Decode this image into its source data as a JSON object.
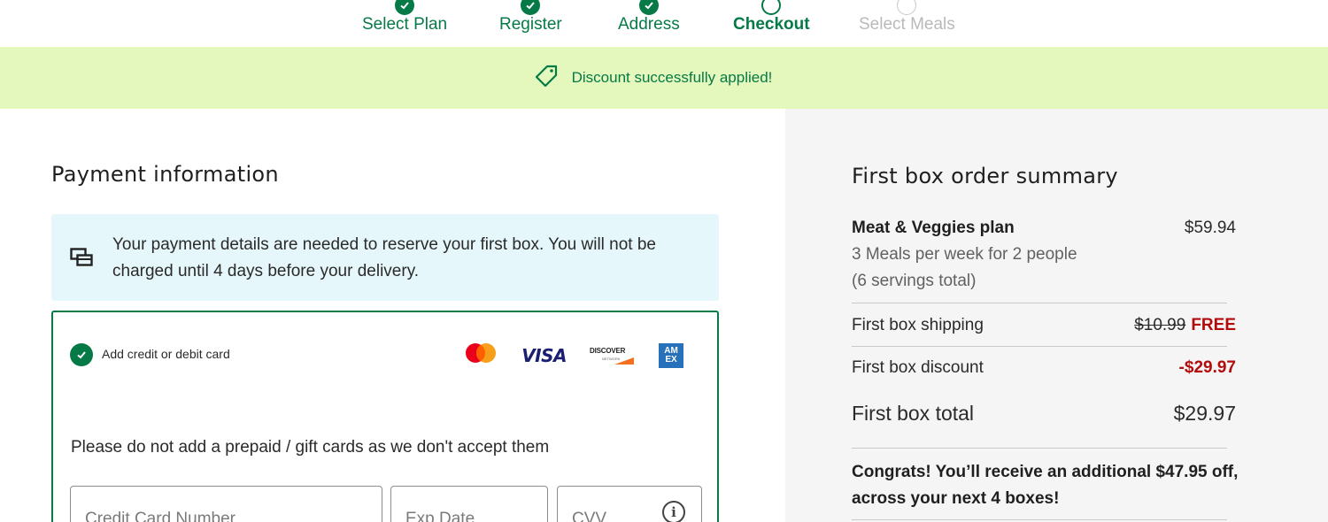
{
  "stepper": {
    "steps": [
      {
        "label": "Select Plan",
        "state": "done"
      },
      {
        "label": "Register",
        "state": "done"
      },
      {
        "label": "Address",
        "state": "done"
      },
      {
        "label": "Checkout",
        "state": "current"
      },
      {
        "label": "Select Meals",
        "state": "todo"
      }
    ]
  },
  "banner": {
    "icon": "tag-icon",
    "message": "Discount successfully applied!"
  },
  "payment": {
    "title": "Payment information",
    "info_icon": "cards-icon",
    "info_text": "Your payment details are needed to reserve your first box. You will not be charged until 4 days before your delivery.",
    "add_card_label": "Add credit or debit card",
    "brands": {
      "visa": "VISA",
      "discover": "DISCOVER",
      "discover_sub": "NETWORK",
      "amex": "AM EX"
    },
    "prepaid_note": "Please do not add a prepaid / gift cards as we don't accept them",
    "fields": {
      "card_number_placeholder": "Credit Card Number",
      "exp_date_placeholder": "Exp Date",
      "cvv_placeholder": "CVV",
      "cvv_info_symbol": "i"
    }
  },
  "summary": {
    "title": "First box order summary",
    "plan_name": "Meat & Veggies plan",
    "plan_price": "$59.94",
    "plan_detail_1": "3 Meals per week for 2 people",
    "plan_detail_2": "(6 servings total)",
    "shipping_label": "First box shipping",
    "shipping_original": "$10.99",
    "shipping_value": "FREE",
    "discount_label": "First box discount",
    "discount_value": "-$29.97",
    "total_label": "First box total",
    "total_value": "$29.97",
    "congrats": "Congrats! You’ll receive an additional $47.95 off, across your next 4 boxes!"
  },
  "colors": {
    "brand_green": "#067a46",
    "banner_bg": "#e4f8bd",
    "info_bg": "#e6f7fb",
    "discount_red": "#b30b0b",
    "summary_bg": "#f5f5f5"
  }
}
